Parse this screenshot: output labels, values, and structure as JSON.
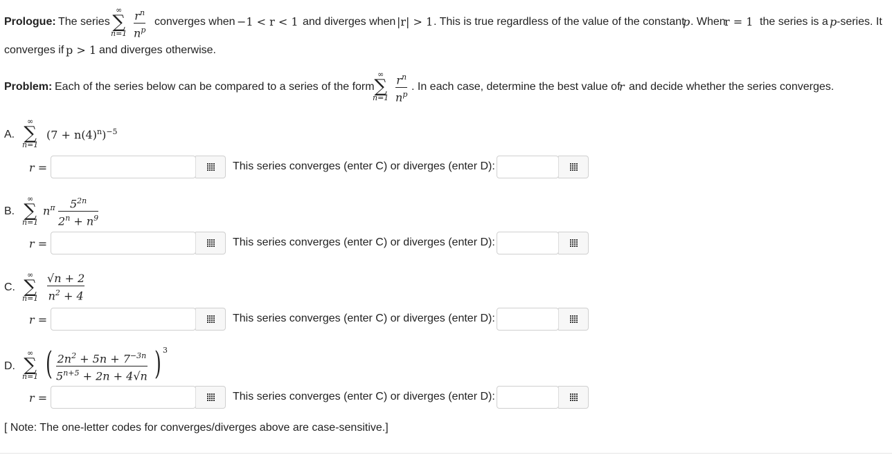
{
  "prologue": {
    "label": "Prologue:",
    "text1": "The series",
    "text2": "converges when",
    "ineq1": "−1 < r < 1",
    "text3": "and diverges when",
    "ineq2": "|r| > 1",
    "text4": ". This is true regardless of the value of the constant",
    "var_p": "p",
    "text5": ". When",
    "eq_r1": "r = 1",
    "text6": "the series is a",
    "text7": "-series. It",
    "line2_text1": "converges if",
    "line2_ineq": "p > 1",
    "line2_text2": "and diverges otherwise."
  },
  "problem": {
    "label": "Problem:",
    "text1": "Each of the series below can be compared to a series of the form",
    "text2": ". In each case, determine the best value of",
    "var_r": "r",
    "text3": "and decide whether the series converges."
  },
  "sigma": {
    "upper": "∞",
    "symbol": "∑",
    "lower": "n=1"
  },
  "general_term": {
    "num": "r",
    "num_sup": "n",
    "den": "n",
    "den_sup": "p"
  },
  "parts": [
    {
      "letter": "A."
    },
    {
      "letter": "B."
    },
    {
      "letter": "C."
    },
    {
      "letter": "D."
    }
  ],
  "expressions": {
    "a": {
      "base": "(7 + n(4)",
      "inner_sup": "n",
      "close": ")",
      "outer_sup": "−5"
    },
    "b": {
      "factor": "n",
      "factor_sup": "π",
      "num": "5",
      "num_sup": "2n",
      "den": "2",
      "den_sup": "n",
      "den_rest": "+ n",
      "den_rest_sup": "9"
    },
    "c": {
      "num": "√n + 2",
      "den": "n",
      "den_sup": "2",
      "den_rest": "+ 4"
    },
    "d": {
      "num_a": "2n",
      "num_a_sup": "2",
      "num_b": "+ 5n + 7",
      "num_b_sup": "−3n",
      "den_a": "5",
      "den_a_sup": "n+5",
      "den_b": "+ 2n + 4√n",
      "outer_sup": "3"
    }
  },
  "r_label": "r =",
  "converge_prompt": "This series converges (enter C) or diverges (enter D):",
  "inputs": {
    "r_value": "",
    "cd_value": ""
  },
  "note": "[ Note: The one-letter codes for converges/diverges above are case-sensitive.]"
}
